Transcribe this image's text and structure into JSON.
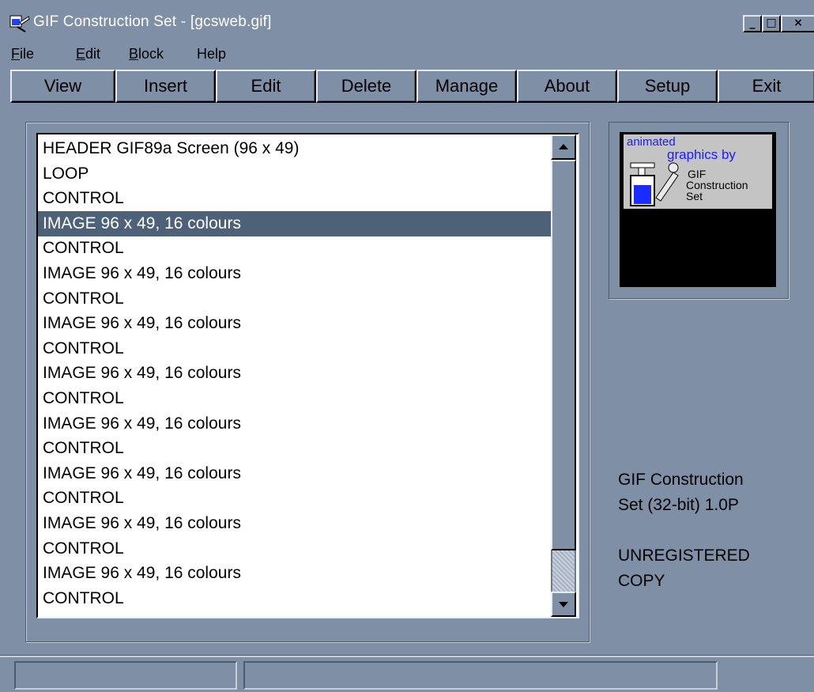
{
  "window": {
    "title": "GIF Construction Set - [gcsweb.gif]",
    "controls": {
      "minimize": "_",
      "maximize": "□",
      "close": "×"
    }
  },
  "menu": {
    "file": {
      "label": "ile",
      "mnemonic": "F"
    },
    "edit": {
      "label": "dit",
      "mnemonic": "E"
    },
    "block": {
      "label": "lock",
      "mnemonic": "B"
    },
    "help": {
      "label": "Help"
    }
  },
  "toolbar": {
    "view": "View",
    "insert": "Insert",
    "edit": "Edit",
    "delete": "Delete",
    "manage": "Manage",
    "about": "About",
    "setup": "Setup",
    "exit": "Exit"
  },
  "blocks": [
    "HEADER GIF89a Screen (96 x 49)",
    "LOOP",
    "CONTROL",
    "IMAGE 96 x 49, 16 colours",
    "CONTROL",
    "IMAGE 96 x 49, 16 colours",
    "CONTROL",
    "IMAGE 96 x 49, 16 colours",
    "CONTROL",
    "IMAGE 96 x 49, 16 colours",
    "CONTROL",
    "IMAGE 96 x 49, 16 colours",
    "CONTROL",
    "IMAGE 96 x 49, 16 colours",
    "CONTROL",
    "IMAGE 96 x 49, 16 colours",
    "CONTROL",
    "IMAGE 96 x 49, 16 colours",
    "CONTROL"
  ],
  "selected_index": 3,
  "preview": {
    "line1": "animated",
    "line2": "graphics by",
    "line3": "GIF",
    "line4": "Construction",
    "line5": "Set"
  },
  "info": {
    "product_line1": "GIF Construction",
    "product_line2": "Set (32-bit) 1.0P",
    "reg_line1": "UNREGISTERED",
    "reg_line2": "COPY"
  },
  "colors": {
    "face": "#7e8fa6",
    "selection": "#4d6279",
    "preview_text": "#1a1aff"
  }
}
